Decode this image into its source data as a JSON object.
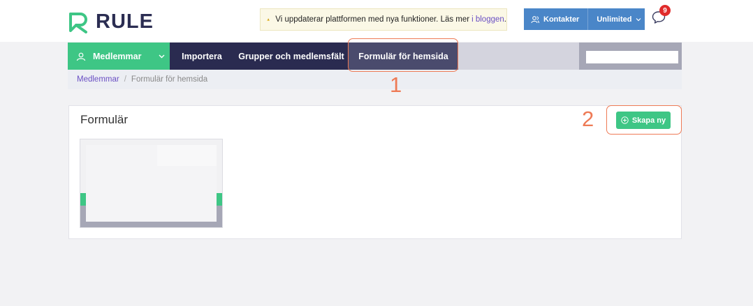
{
  "header": {
    "logo_text": "RULE",
    "notice": {
      "text": "Vi uppdaterar plattformen med nya funktioner. Läs mer",
      "link": "i bloggen",
      "suffix": "."
    },
    "contacts_label": "Kontakter",
    "plan_label": "Unlimited",
    "notifications_count": "9"
  },
  "nav": {
    "members_label": "Medlemmar",
    "items": [
      {
        "label": "Importera"
      },
      {
        "label": "Grupper och medlemsfält"
      },
      {
        "label": "Formulär för hemsida"
      }
    ],
    "search_placeholder": ""
  },
  "breadcrumb": {
    "root": "Medlemmar",
    "separator": "/",
    "current": "Formulär för hemsida"
  },
  "panel": {
    "title": "Formulär",
    "create_button": "Skapa ny"
  },
  "annotations": {
    "one": "1",
    "two": "2"
  },
  "colors": {
    "brand_green": "#3ec685",
    "nav_dark": "#2a2b50",
    "nav_active": "#4a4b6d",
    "contacts_blue": "#4a86c8",
    "annotation_orange": "#ee7a55",
    "badge_red": "#e02b2b",
    "link_purple": "#6a4fc4"
  }
}
